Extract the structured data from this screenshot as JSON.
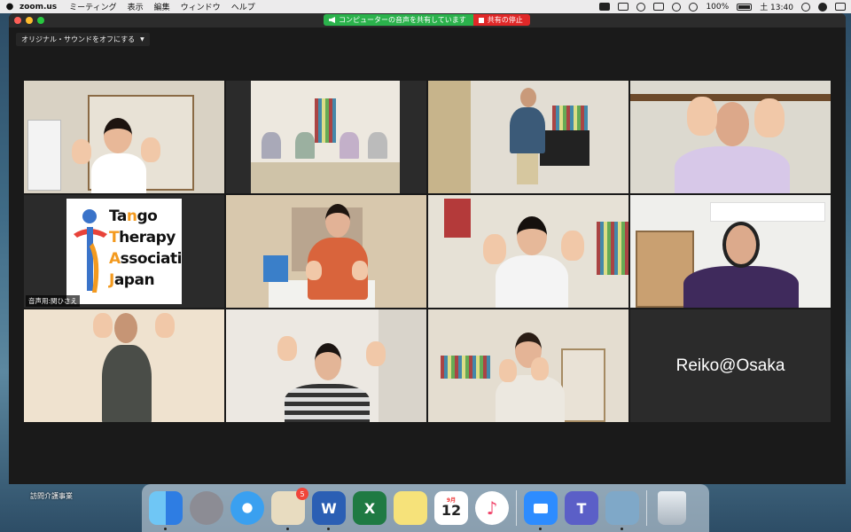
{
  "menubar": {
    "app_name": "zoom.us",
    "menus": [
      "ミーティング",
      "表示",
      "編集",
      "ウィンドウ",
      "ヘルプ"
    ],
    "battery": "100%",
    "clock": "土 13:40"
  },
  "share": {
    "status_label": "コンピューターの音声を共有しています",
    "stop_label": "共有の停止"
  },
  "audio_button": {
    "label": "オリジナル・サウンドをオフにする"
  },
  "tiles": {
    "logo": {
      "line1_a": "Ta",
      "line1_b": "n",
      "line1_c": "g",
      "line1_d": "o",
      "line2_a": "T",
      "line2_b": "herapy",
      "line3_a": "A",
      "line3_b": "ssociati",
      "line4_a": "J",
      "line4_b": "apan",
      "label": "音声用:関ひさえ"
    },
    "name_only": {
      "name": "Reiko@Osaka"
    }
  },
  "desktop": {
    "label": "訪問介護事業"
  },
  "dock": {
    "mail_badge": "5",
    "calendar_month": "9月",
    "calendar_day": "12",
    "word_letter": "W",
    "excel_letter": "X",
    "teams_letter": "T"
  },
  "colors": {
    "active_speaker": "#d9e66b",
    "share_green": "#2bb24c",
    "share_red": "#e02828",
    "logo_orange": "#f39a1f"
  }
}
